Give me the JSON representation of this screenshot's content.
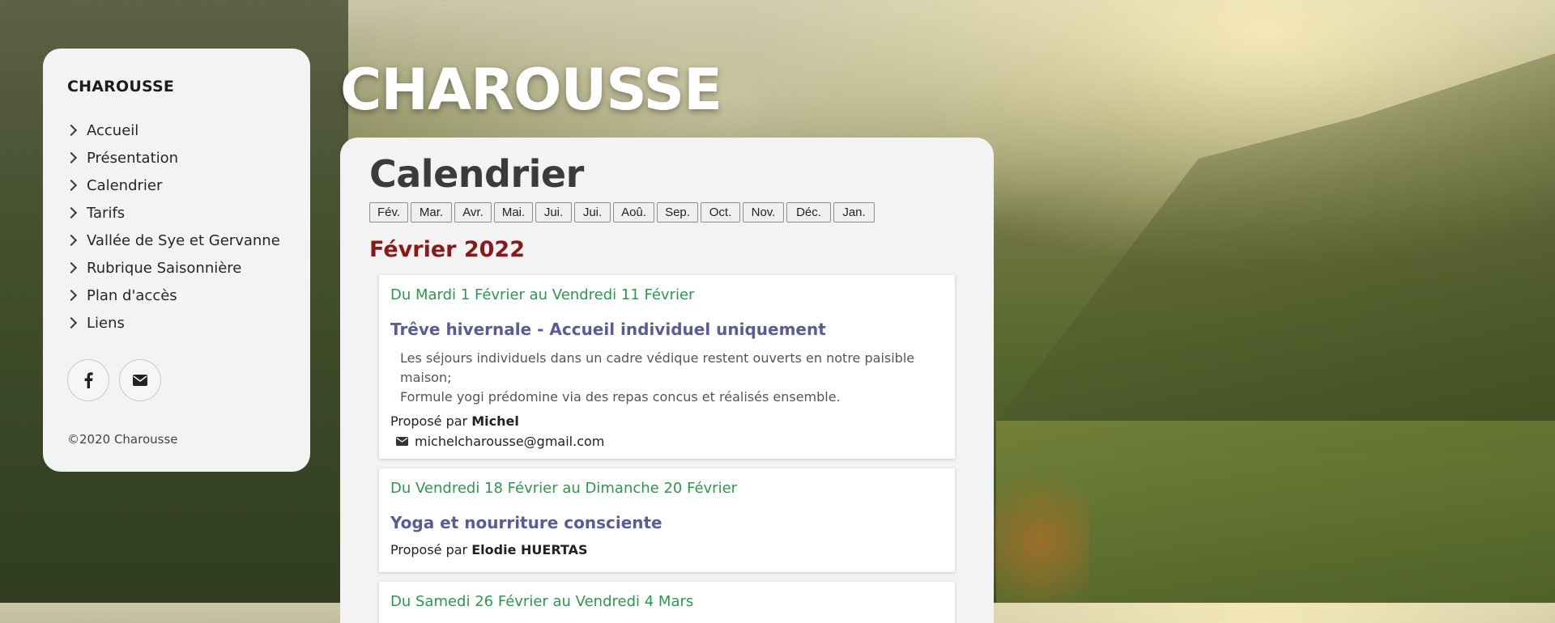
{
  "site": {
    "name": "CHAROUSSE",
    "hero_title": "CHAROUSSE",
    "copyright": "©2020 Charousse"
  },
  "nav": {
    "items": [
      {
        "label": "Accueil"
      },
      {
        "label": "Présentation"
      },
      {
        "label": "Calendrier"
      },
      {
        "label": "Tarifs"
      },
      {
        "label": "Vallée de Sye et Gervanne"
      },
      {
        "label": "Rubrique Saisonnière"
      },
      {
        "label": "Plan d'accès"
      },
      {
        "label": "Liens"
      }
    ]
  },
  "socials": [
    {
      "icon": "facebook-icon"
    },
    {
      "icon": "envelope-icon"
    }
  ],
  "page": {
    "title": "Calendrier",
    "months": [
      "Fév.",
      "Mar.",
      "Avr.",
      "Mai.",
      "Jui.",
      "Jui.",
      "Aoû.",
      "Sep.",
      "Oct.",
      "Nov.",
      "Déc.",
      "Jan."
    ],
    "month_heading": "Février 2022"
  },
  "events": [
    {
      "dates": "Du Mardi 1 Février au Vendredi 11 Février",
      "title": "Trêve hivernale - Accueil individuel uniquement",
      "desc_line1": "Les séjours individuels dans un cadre védique restent ouverts en notre paisible maison;",
      "desc_line2": "Formule yogi prédomine via des repas concus et réalisés ensemble.",
      "by_prefix": "Proposé par",
      "author": "Michel",
      "email": "michelcharousse@gmail.com"
    },
    {
      "dates": "Du Vendredi 18 Février au Dimanche 20 Février",
      "title": "Yoga et nourriture consciente",
      "by_prefix": "Proposé par",
      "author": "Elodie HUERTAS"
    },
    {
      "dates": "Du Samedi 26 Février au Vendredi 4 Mars"
    }
  ],
  "colors": {
    "panel_bg": "#f3f3f3",
    "month_heading": "#8a1a1a",
    "event_dates": "#2a9a4a",
    "event_title": "#5a5c98"
  }
}
